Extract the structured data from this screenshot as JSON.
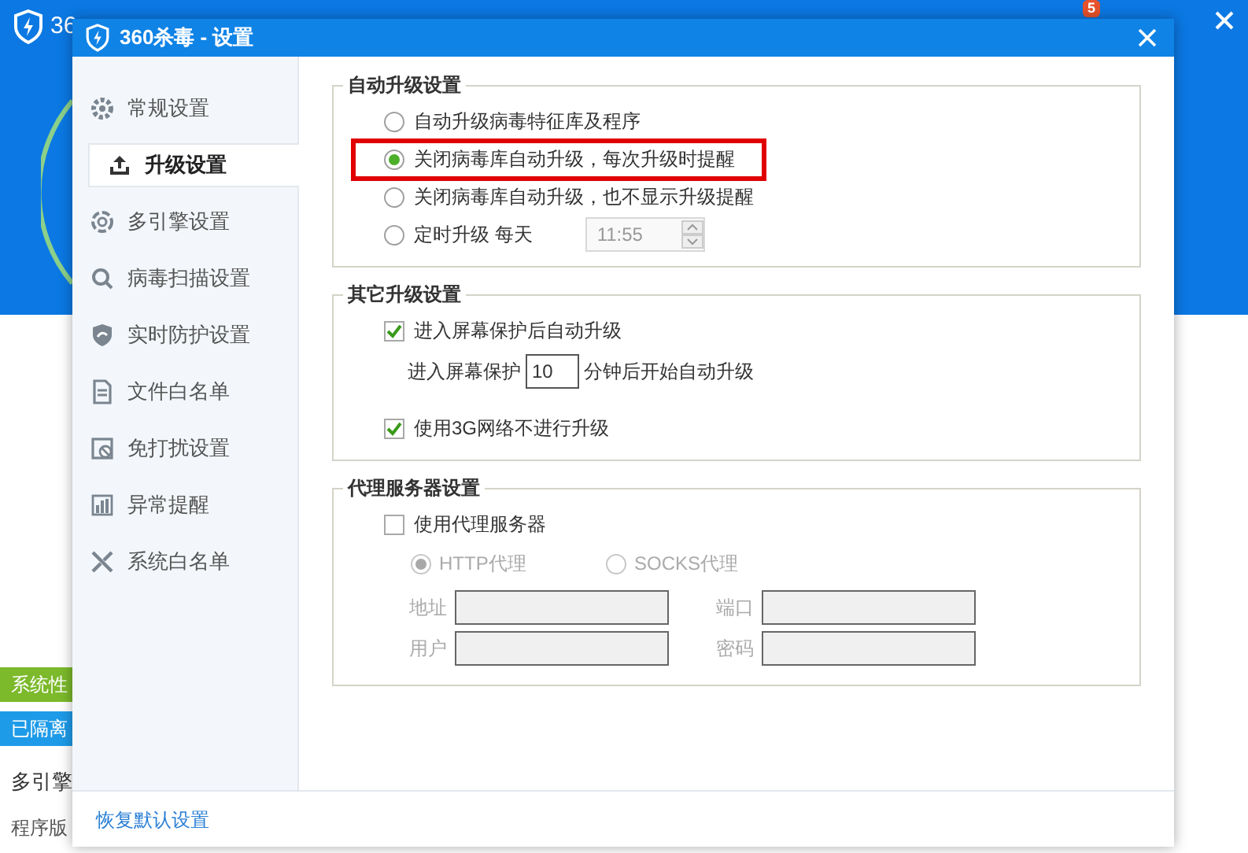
{
  "background_app": {
    "title": "36",
    "badge": "5",
    "side_labels": [
      {
        "text": "系统性",
        "kind": "green"
      },
      {
        "text": "已隔离",
        "kind": "blue"
      },
      {
        "text": "多引擎",
        "kind": "plain"
      },
      {
        "text": "程序版",
        "kind": "small"
      }
    ]
  },
  "window": {
    "title": "360杀毒 - 设置"
  },
  "sidebar": {
    "items": [
      {
        "label": "常规设置",
        "selected": false
      },
      {
        "label": "升级设置",
        "selected": true
      },
      {
        "label": "多引擎设置",
        "selected": false
      },
      {
        "label": "病毒扫描设置",
        "selected": false
      },
      {
        "label": "实时防护设置",
        "selected": false
      },
      {
        "label": "文件白名单",
        "selected": false
      },
      {
        "label": "免打扰设置",
        "selected": false
      },
      {
        "label": "异常提醒",
        "selected": false
      },
      {
        "label": "系统白名单",
        "selected": false
      }
    ]
  },
  "auto_upgrade": {
    "title": "自动升级设置",
    "options": [
      {
        "label": "自动升级病毒特征库及程序",
        "selected": false,
        "highlighted": false
      },
      {
        "label": "关闭病毒库自动升级，每次升级时提醒",
        "selected": true,
        "highlighted": true
      },
      {
        "label": "关闭病毒库自动升级，也不显示升级提醒",
        "selected": false,
        "highlighted": false
      },
      {
        "label": "定时升级 每天",
        "selected": false,
        "highlighted": false,
        "time": "11:55"
      }
    ]
  },
  "other_upgrade": {
    "title": "其它升级设置",
    "screensaver": {
      "label": "进入屏幕保护后自动升级",
      "checked": true
    },
    "delay_prefix": "进入屏幕保护",
    "delay_value": "10",
    "delay_suffix": "分钟后开始自动升级",
    "no_3g": {
      "label": "使用3G网络不进行升级",
      "checked": true
    }
  },
  "proxy": {
    "title": "代理服务器设置",
    "use_proxy": {
      "label": "使用代理服务器",
      "checked": false
    },
    "types": [
      {
        "label": "HTTP代理",
        "selected": true
      },
      {
        "label": "SOCKS代理",
        "selected": false
      }
    ],
    "fields": [
      {
        "label": "地址"
      },
      {
        "label": "端口"
      },
      {
        "label": "用户"
      },
      {
        "label": "密码"
      }
    ]
  },
  "footer": {
    "link": "恢复默认设置"
  }
}
